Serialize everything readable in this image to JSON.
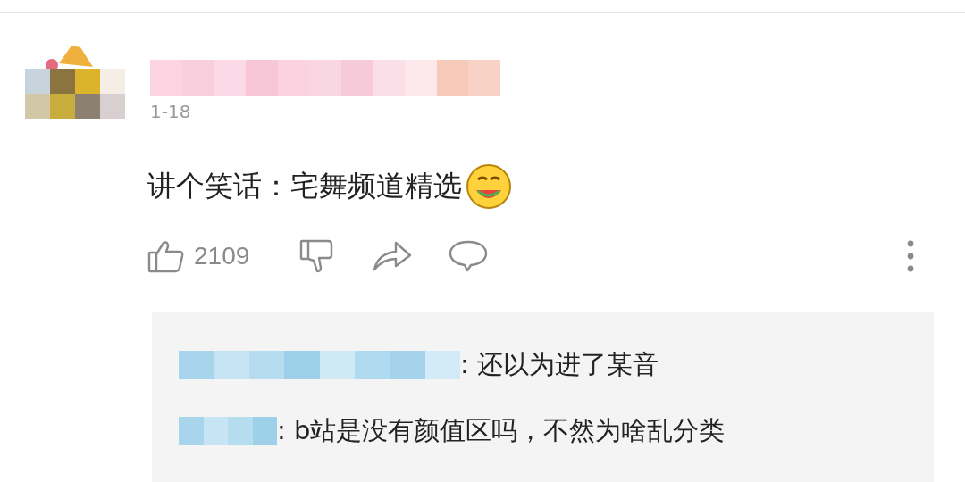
{
  "comment": {
    "date": "1-18",
    "text": "讲个笑话：宅舞频道精选",
    "likes": "2109"
  },
  "replies": [
    {
      "text": ": 还以为进了某音"
    },
    {
      "text": ": b站是没有颜值区吗，不然为啥乱分类"
    }
  ]
}
